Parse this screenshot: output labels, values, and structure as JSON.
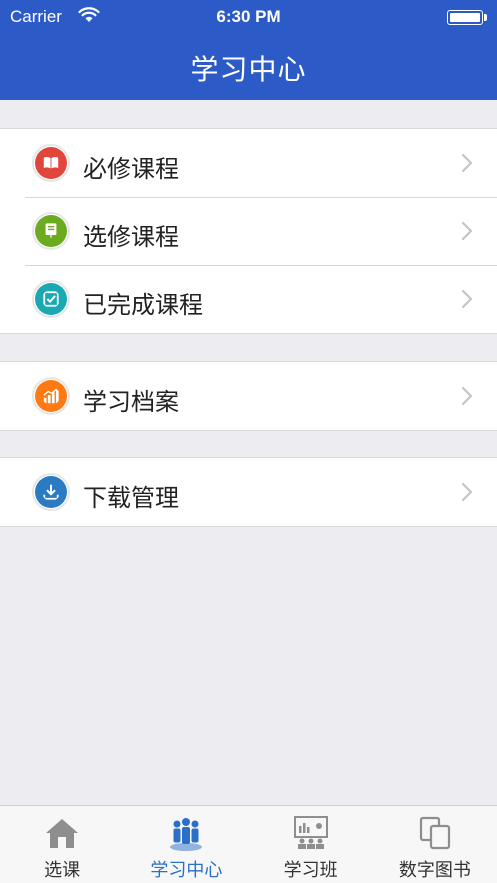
{
  "status": {
    "carrier": "Carrier",
    "time": "6:30 PM"
  },
  "header": {
    "title": "学习中心"
  },
  "groups": {
    "courses": [
      {
        "label": "必修课程",
        "icon": "book-icon",
        "color": "#e0463c"
      },
      {
        "label": "选修课程",
        "icon": "pen-icon",
        "color": "#6cab1f"
      },
      {
        "label": "已完成课程",
        "icon": "checklist-icon",
        "color": "#1aa9b3"
      }
    ],
    "archive": [
      {
        "label": "学习档案",
        "icon": "bar-chart-icon",
        "color": "#ff7a12"
      }
    ],
    "download": [
      {
        "label": "下载管理",
        "icon": "download-icon",
        "color": "#2b7bc2"
      }
    ]
  },
  "tabbar": {
    "items": [
      {
        "label": "选课",
        "icon": "home-icon",
        "active": false
      },
      {
        "label": "学习中心",
        "icon": "people-icon",
        "active": true
      },
      {
        "label": "学习班",
        "icon": "classroom-icon",
        "active": false
      },
      {
        "label": "数字图书",
        "icon": "pages-icon",
        "active": false
      }
    ],
    "active_color": "#2c6fc8",
    "inactive_color": "#8e8e8e"
  },
  "colors": {
    "header_bg": "#2c5bc8",
    "page_bg": "#ececf1"
  }
}
